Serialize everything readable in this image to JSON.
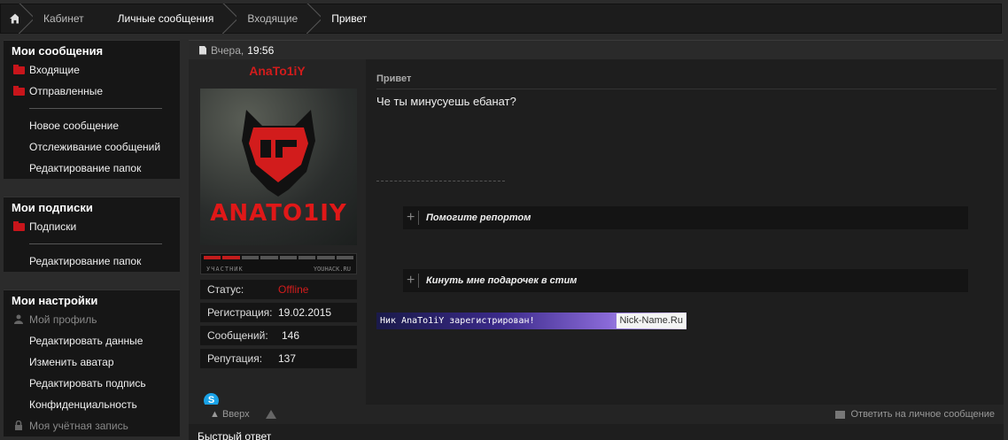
{
  "breadcrumb": {
    "items": [
      "Кабинет",
      "Личные сообщения",
      "Входящие",
      "Привет"
    ]
  },
  "sidebar": {
    "messages": {
      "title": "Мои сообщения",
      "folders": [
        "Входящие",
        "Отправленные"
      ],
      "links": [
        "Новое сообщение",
        "Отслеживание сообщений",
        "Редактирование папок"
      ]
    },
    "subscriptions": {
      "title": "Мои подписки",
      "folders": [
        "Подписки"
      ],
      "links": [
        "Редактирование папок"
      ]
    },
    "settings": {
      "title": "Мои настройки",
      "profile": "Мой профиль",
      "links": [
        "Редактировать данные",
        "Изменить аватар",
        "Редактировать подпись",
        "Конфиденциальность"
      ],
      "account": "Моя учётная запись"
    }
  },
  "message": {
    "date": "Вчера,",
    "time": "19:56",
    "title": "Привет",
    "body": "Че ты минусуешь ебанат?",
    "spoilers": [
      "Помогите репортом",
      "Кинуть мне подарочек в стим"
    ],
    "nick_banner": {
      "text": "Ник AnaTo1iY зарегистрирован!",
      "site": "Nick-Name.Ru"
    }
  },
  "user": {
    "name": "AnaTo1iY",
    "avatar_text": "ANATO1IY",
    "rank_label": "УЧАСТНИК",
    "rank_site": "YOUHACK.RU",
    "rank_progress": 0.25,
    "stats": [
      {
        "key": "Статус:",
        "value": "Offline"
      },
      {
        "key": "Регистрация:",
        "value": "19.02.2015"
      },
      {
        "key": "Сообщений:",
        "value": "146"
      },
      {
        "key": "Репутация:",
        "value": "137"
      }
    ]
  },
  "footer": {
    "up": "▲ Вверх",
    "reply": "Ответить на личное сообщение",
    "quick_reply": "Быстрый ответ"
  },
  "colors": {
    "accent_red": "#d21c1c",
    "background": "#2b2b2b",
    "panel": "#1e1e1e"
  }
}
